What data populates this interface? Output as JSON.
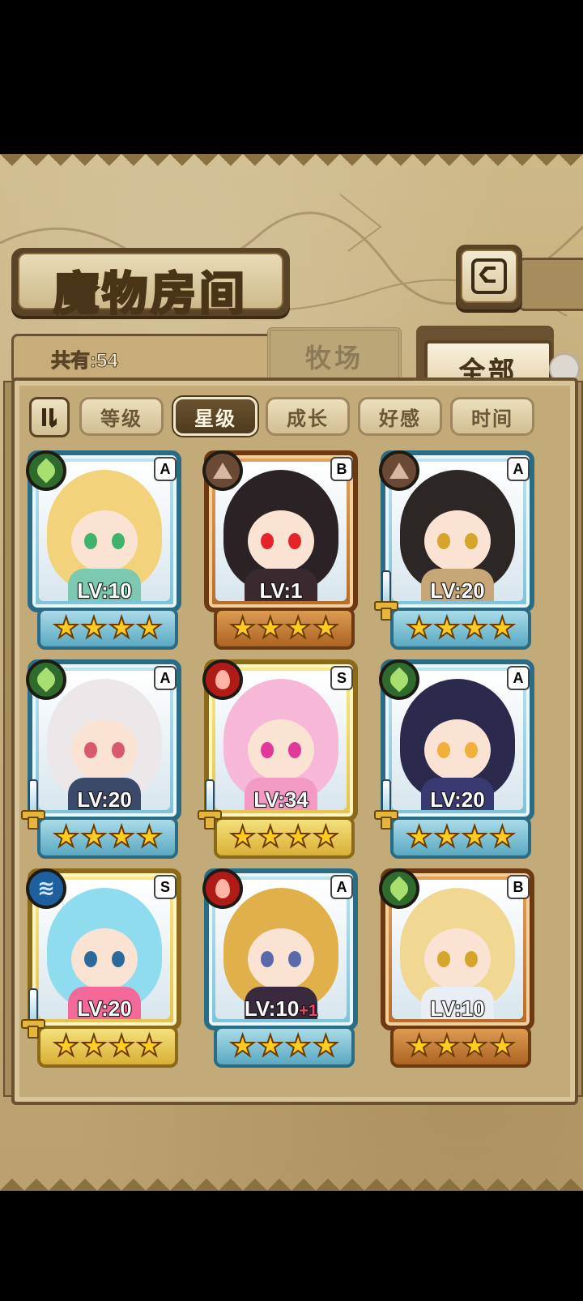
{
  "screen": {
    "title": "魔物房间",
    "count_label": "共有:54",
    "tabs": [
      {
        "label": "牧场",
        "active": false
      },
      {
        "label": "全部",
        "active": true
      }
    ]
  },
  "sort": {
    "buttons": [
      {
        "label": "等级",
        "active": false
      },
      {
        "label": "星级",
        "active": true
      },
      {
        "label": "成长",
        "active": false
      },
      {
        "label": "好感",
        "active": false
      },
      {
        "label": "时间",
        "active": false
      }
    ]
  },
  "monsters": [
    {
      "level": "LV:10",
      "level_bonus": "",
      "rank": "A",
      "element": "leaf",
      "frame": "blue",
      "stars": 4,
      "weapon": false,
      "hair_color": "#f2d27a",
      "eye_color": "#3fb36b",
      "body_color": "#7cc8b0"
    },
    {
      "level": "LV:1",
      "level_bonus": "",
      "rank": "B",
      "element": "earth",
      "frame": "bronze",
      "stars": 4,
      "weapon": false,
      "hair_color": "#2a2224",
      "eye_color": "#e3242b",
      "body_color": "#3a2a30"
    },
    {
      "level": "LV:20",
      "level_bonus": "",
      "rank": "A",
      "element": "earth",
      "frame": "blue",
      "stars": 4,
      "weapon": true,
      "hair_color": "#2c2624",
      "eye_color": "#d4a52a",
      "body_color": "#c7a678"
    },
    {
      "level": "LV:20",
      "level_bonus": "",
      "rank": "A",
      "element": "leaf",
      "frame": "blue",
      "stars": 4,
      "weapon": true,
      "hair_color": "#ece8ea",
      "eye_color": "#d85a6a",
      "body_color": "#3c4a6a"
    },
    {
      "level": "LV:34",
      "level_bonus": "",
      "rank": "S",
      "element": "fire",
      "frame": "gold",
      "stars": 4,
      "weapon": true,
      "hair_color": "#f7b8d8",
      "eye_color": "#e0399a",
      "body_color": "#f39ac4"
    },
    {
      "level": "LV:20",
      "level_bonus": "",
      "rank": "A",
      "element": "leaf",
      "frame": "blue",
      "stars": 4,
      "weapon": true,
      "hair_color": "#2c2a4c",
      "eye_color": "#f0b03a",
      "body_color": "#3a3a72"
    },
    {
      "level": "LV:20",
      "level_bonus": "",
      "rank": "S",
      "element": "water",
      "frame": "gold",
      "stars": 4,
      "weapon": true,
      "hair_color": "#8fdcef",
      "eye_color": "#2a6a9a",
      "body_color": "#f36a9a"
    },
    {
      "level": "LV:10",
      "level_bonus": "+1",
      "rank": "A",
      "element": "fire",
      "frame": "blue",
      "stars": 4,
      "weapon": false,
      "hair_color": "#e0b04a",
      "eye_color": "#5a6aa8",
      "body_color": "#3a2a3e"
    },
    {
      "level": "LV:10",
      "level_bonus": "",
      "rank": "B",
      "element": "leaf",
      "frame": "bronze",
      "stars": 4,
      "weapon": false,
      "hair_color": "#f0d792",
      "eye_color": "#d4a52a",
      "body_color": "#e9eef4"
    }
  ],
  "colors": {
    "parchment": "#c2a978",
    "frame_dark": "#5a4426",
    "star": "#ffcc22"
  }
}
